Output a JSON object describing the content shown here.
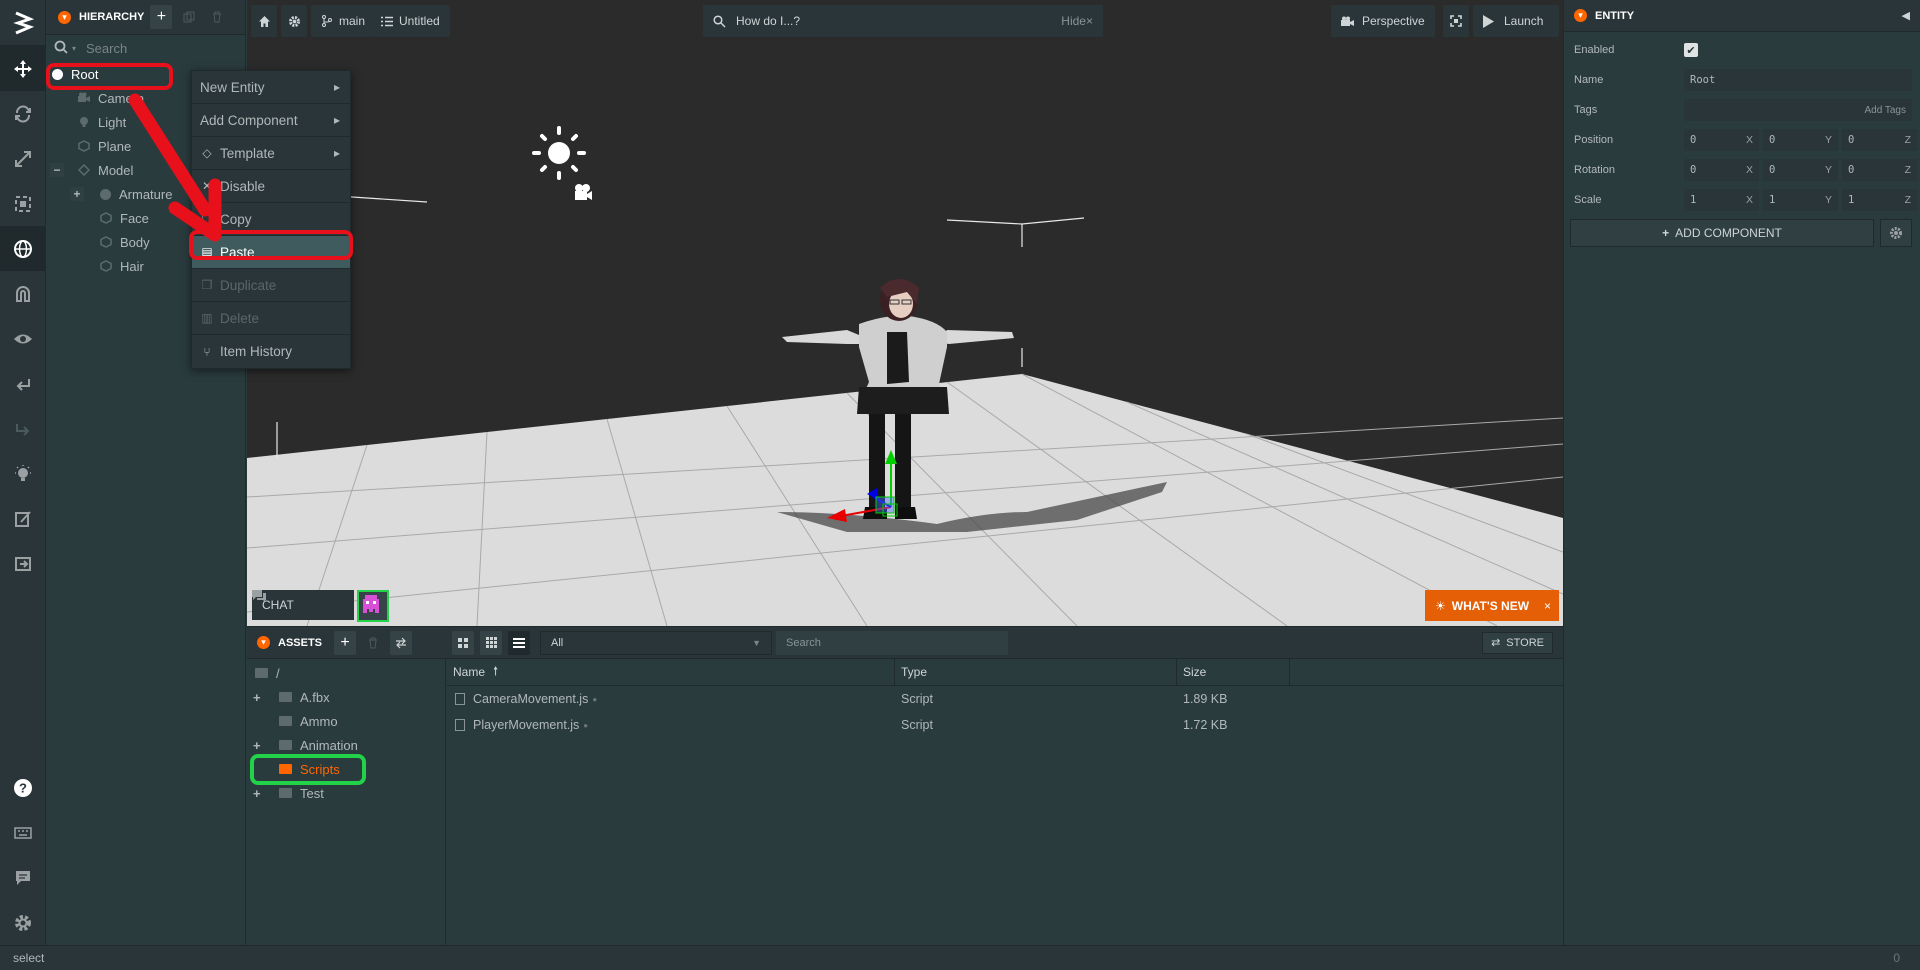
{
  "hierarchy": {
    "title": "HIERARCHY",
    "search_placeholder": "Search",
    "items": [
      {
        "label": "Root"
      },
      {
        "label": "Camera"
      },
      {
        "label": "Light"
      },
      {
        "label": "Plane"
      },
      {
        "label": "Model"
      },
      {
        "label": "Armature"
      },
      {
        "label": "Face"
      },
      {
        "label": "Body"
      },
      {
        "label": "Hair"
      }
    ]
  },
  "context_menu": {
    "items": [
      {
        "label": "New Entity"
      },
      {
        "label": "Add Component"
      },
      {
        "label": "Template"
      },
      {
        "label": "Disable"
      },
      {
        "label": "Copy"
      },
      {
        "label": "Paste"
      },
      {
        "label": "Duplicate"
      },
      {
        "label": "Delete"
      },
      {
        "label": "Item History"
      }
    ]
  },
  "topbar": {
    "branch": "main",
    "scene": "Untitled",
    "help_search": "How do I...?",
    "hide": "Hide",
    "camera": "Perspective",
    "launch": "Launch"
  },
  "viewport": {
    "chat": "CHAT",
    "whats_new": "WHAT'S NEW"
  },
  "inspector": {
    "title": "ENTITY",
    "enabled_label": "Enabled",
    "name_label": "Name",
    "name_value": "Root",
    "tags_label": "Tags",
    "tags_placeholder": "Add Tags",
    "position_label": "Position",
    "rotation_label": "Rotation",
    "scale_label": "Scale",
    "position": [
      "0",
      "0",
      "0"
    ],
    "rotation": [
      "0",
      "0",
      "0"
    ],
    "scale": [
      "1",
      "1",
      "1"
    ],
    "axes": [
      "X",
      "Y",
      "Z"
    ],
    "add_component": "ADD COMPONENT"
  },
  "assets": {
    "title": "ASSETS",
    "filter": "All",
    "search_placeholder": "Search",
    "store": "STORE",
    "tree": [
      {
        "label": "/"
      },
      {
        "label": "A.fbx"
      },
      {
        "label": "Ammo"
      },
      {
        "label": "Animation"
      },
      {
        "label": "Scripts"
      },
      {
        "label": "Test"
      }
    ],
    "columns": [
      "Name",
      "Type",
      "Size"
    ],
    "rows": [
      {
        "name": "CameraMovement.js",
        "type": "Script",
        "size": "1.89 KB"
      },
      {
        "name": "PlayerMovement.js",
        "type": "Script",
        "size": "1.72 KB"
      }
    ]
  },
  "status": {
    "text": "select",
    "count": "0"
  },
  "colors": {
    "accent": "#ff6600",
    "highlight_red": "#e8101a",
    "highlight_green": "#22d34a"
  }
}
